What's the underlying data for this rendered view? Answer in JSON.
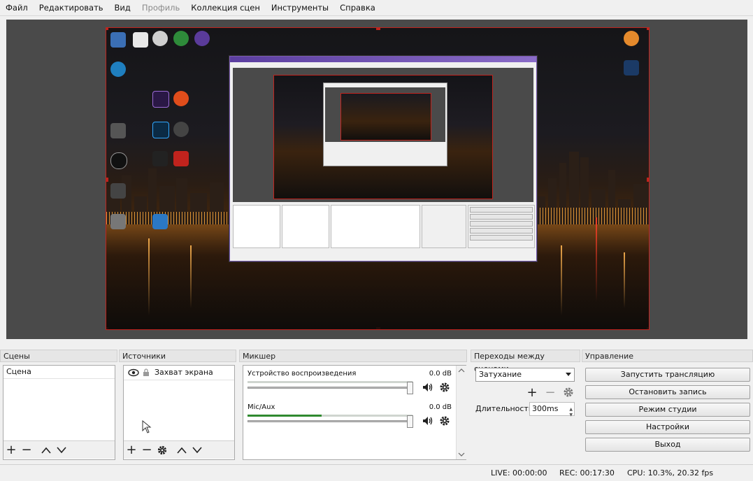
{
  "menu": [
    "Файл",
    "Редактировать",
    "Вид",
    "Профиль",
    "Коллекция сцен",
    "Инструменты",
    "Справка"
  ],
  "menu_disabled_index": 3,
  "docks": {
    "scenes": "Сцены",
    "sources": "Источники",
    "mixer": "Микшер",
    "transitions": "Переходы между сценами",
    "controls": "Управление"
  },
  "scenes": [
    "Сцена"
  ],
  "sources": [
    {
      "name": "Захват экрана",
      "visible": true,
      "locked": false
    }
  ],
  "mixer": [
    {
      "name": "Устройство воспроизведения",
      "db": "0.0 dB",
      "level": 0.0
    },
    {
      "name": "Mic/Aux",
      "db": "0.0 dB",
      "level": 0.45
    }
  ],
  "transitions": {
    "selected": "Затухание",
    "duration_label": "Длительность",
    "duration_value": "300ms"
  },
  "controls": [
    "Запустить трансляцию",
    "Остановить запись",
    "Режим студии",
    "Настройки",
    "Выход"
  ],
  "status": {
    "live": "LIVE: 00:00:00",
    "rec": "REC: 00:17:30",
    "cpu": "CPU: 10.3%, 20.32 fps"
  },
  "colors": {
    "accent_red": "#c0231d",
    "preview_bg": "#4a4a4a",
    "meter_green": "#2f8a2f"
  }
}
